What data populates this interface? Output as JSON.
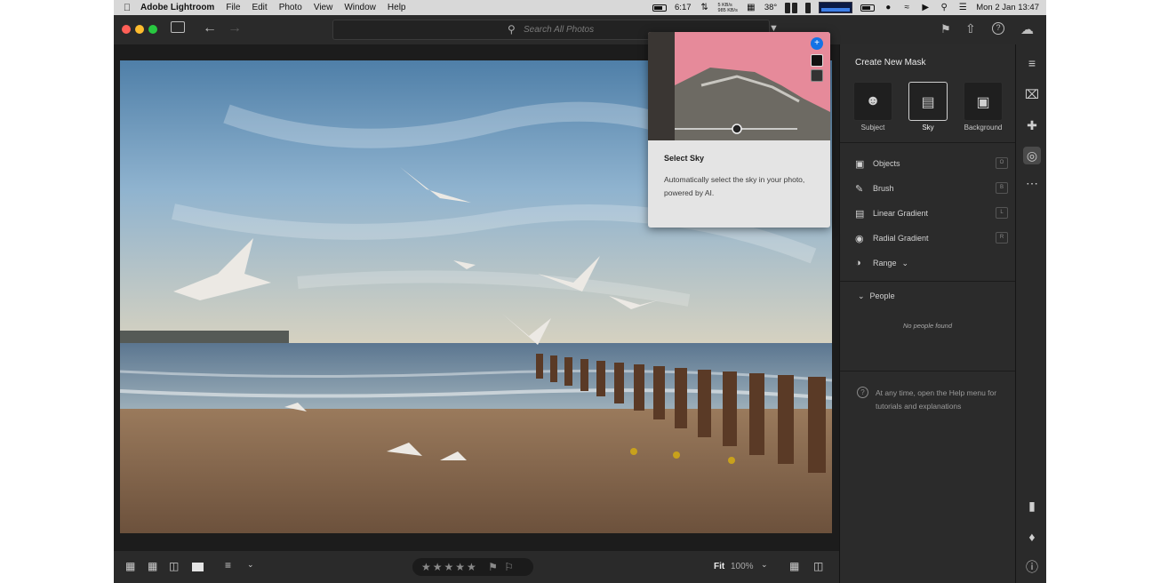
{
  "menubar": {
    "app_name": "Adobe Lightroom",
    "menus": [
      "File",
      "Edit",
      "Photo",
      "View",
      "Window",
      "Help"
    ],
    "battery_time": "6:17",
    "net_up": "5 KB/s",
    "net_down": "985 KB/s",
    "temperature": "38°",
    "datetime": "Mon 2 Jan  13:47"
  },
  "toolbar": {
    "search_placeholder": "Search All Photos"
  },
  "panel": {
    "title": "Create New Mask",
    "mask_types": [
      {
        "label": "Subject",
        "icon": "subject-icon"
      },
      {
        "label": "Sky",
        "icon": "sky-icon",
        "selected": true
      },
      {
        "label": "Background",
        "icon": "background-icon"
      }
    ],
    "tools": [
      {
        "label": "Objects",
        "key": "O",
        "icon": "objects-icon"
      },
      {
        "label": "Brush",
        "key": "B",
        "icon": "brush-icon"
      },
      {
        "label": "Linear Gradient",
        "key": "L",
        "icon": "linear-gradient-icon"
      },
      {
        "label": "Radial Gradient",
        "key": "R",
        "icon": "radial-gradient-icon"
      },
      {
        "label": "Range",
        "icon": "range-icon"
      }
    ],
    "people_header": "People",
    "no_people": "No people found",
    "help_text": "At any time, open the Help menu for tutorials and explanations"
  },
  "popup": {
    "title": "Select Sky",
    "description": "Automatically select the sky in your photo, powered by AI."
  },
  "bottombar": {
    "fit_label": "Fit",
    "zoom": "100%",
    "stars": "★★★★★"
  },
  "colors": {
    "accent_blue": "#1473e6",
    "panel_bg": "#2b2b2b",
    "sky_mask_pink": "#e68a9a"
  }
}
